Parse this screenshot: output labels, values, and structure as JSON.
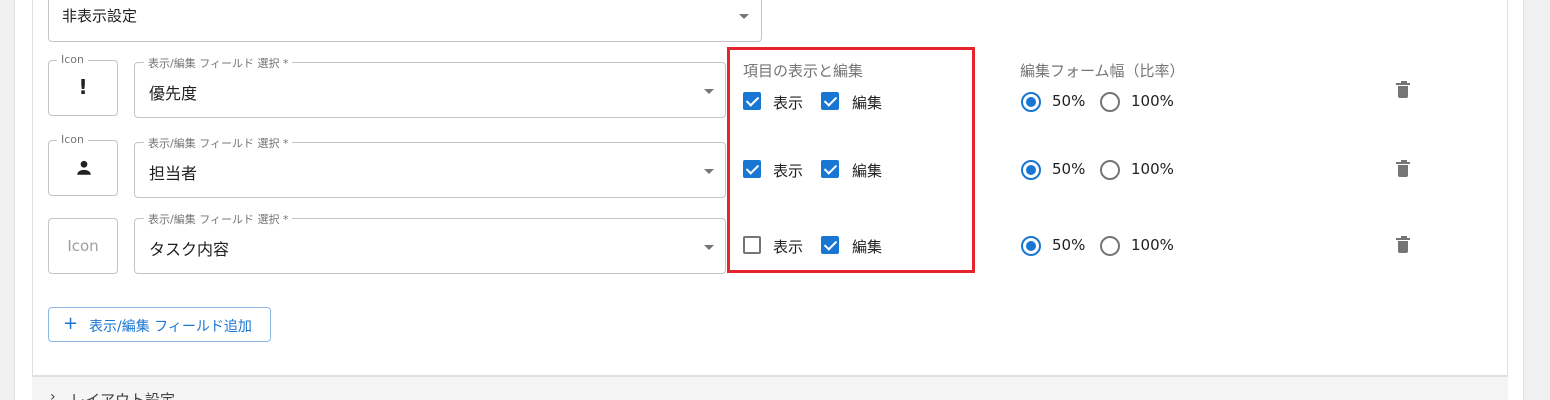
{
  "hidden_settings": {
    "value": "非表示設定"
  },
  "column_headers": {
    "visibility_edit": "項目の表示と編集",
    "form_width": "編集フォーム幅（比率）"
  },
  "rows": [
    {
      "icon_label": "Icon",
      "icon_glyph": "!",
      "icon_name": "priority-exclamation-icon",
      "field_label": "表示/編集 フィールド 選択 *",
      "field_value": "優先度",
      "show_label": "表示",
      "show_checked": true,
      "edit_label": "編集",
      "edit_checked": true,
      "width_50": "50%",
      "width_100": "100%",
      "width_selected": "50%"
    },
    {
      "icon_label": "Icon",
      "icon_glyph": "person",
      "icon_name": "person-icon",
      "field_label": "表示/編集 フィールド 選択 *",
      "field_value": "担当者",
      "show_label": "表示",
      "show_checked": true,
      "edit_label": "編集",
      "edit_checked": true,
      "width_50": "50%",
      "width_100": "100%",
      "width_selected": "50%"
    },
    {
      "icon_label": "Icon",
      "icon_placeholder": "Icon",
      "field_label": "表示/編集 フィールド 選択 *",
      "field_value": "タスク内容",
      "show_label": "表示",
      "show_checked": false,
      "edit_label": "編集",
      "edit_checked": true,
      "width_50": "50%",
      "width_100": "100%",
      "width_selected": "50%"
    }
  ],
  "add_button": {
    "label": "表示/編集 フィールド追加"
  },
  "layout_section": {
    "chevron": "›",
    "label": "レイアウト設定"
  },
  "colors": {
    "accent": "#1976d2",
    "highlight": "#e5242b",
    "icon_gray": "#757575"
  }
}
